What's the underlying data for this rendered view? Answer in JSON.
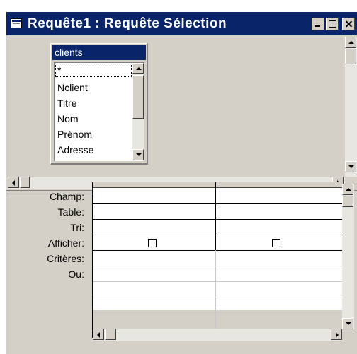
{
  "window": {
    "title": "Requête1 : Requête Sélection"
  },
  "table_box": {
    "name": "clients",
    "fields": [
      "*",
      "Nclient",
      "Titre",
      "Nom",
      "Prénom",
      "Adresse"
    ],
    "selected_field": "*"
  },
  "design_grid": {
    "row_labels": [
      "Champ:",
      "Table:",
      "Tri:",
      "Afficher:",
      "Critères:",
      "Ou:"
    ],
    "columns": [
      {
        "champ": "",
        "table": "",
        "tri": "",
        "afficher": false,
        "criteres": "",
        "ou": ""
      },
      {
        "champ": "",
        "table": "",
        "tri": "",
        "afficher": false,
        "criteres": "",
        "ou": ""
      }
    ]
  }
}
